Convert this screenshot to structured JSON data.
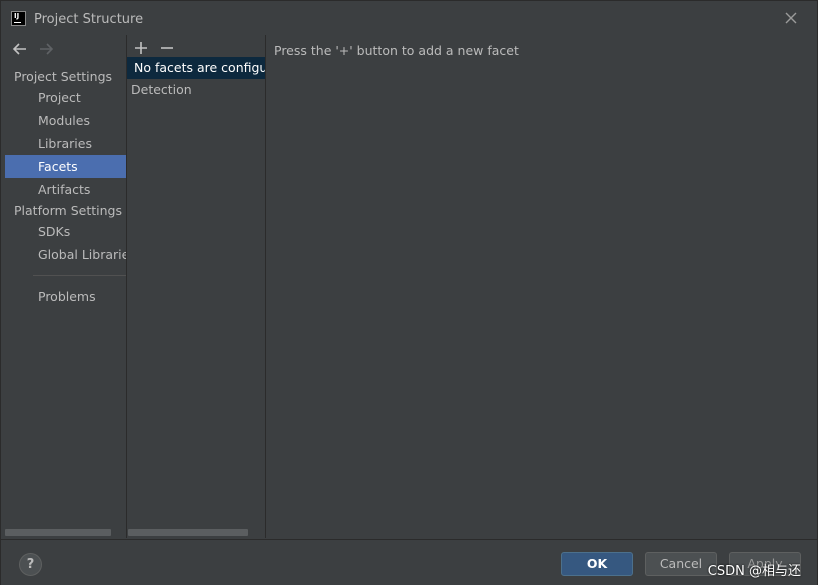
{
  "window": {
    "title": "Project Structure",
    "app_icon_text": "IJ"
  },
  "sidebar": {
    "project_settings_header": "Project Settings",
    "platform_settings_header": "Platform Settings",
    "items": [
      {
        "label": "Project"
      },
      {
        "label": "Modules"
      },
      {
        "label": "Libraries"
      },
      {
        "label": "Facets",
        "selected": true
      },
      {
        "label": "Artifacts"
      },
      {
        "label": "SDKs"
      },
      {
        "label": "Global Libraries"
      },
      {
        "label": "Problems"
      }
    ]
  },
  "facets_list": {
    "add_label": "+",
    "remove_label": "−",
    "rows": [
      {
        "label": "No facets are configured",
        "selected": true
      },
      {
        "label": "Detection"
      }
    ]
  },
  "detail": {
    "hint": "Press the '+' button to add a new facet"
  },
  "footer": {
    "help_label": "?",
    "ok_label": "OK",
    "cancel_label": "Cancel",
    "apply_label": "Apply",
    "watermark": "CSDN @相与还"
  },
  "colors": {
    "background": "#3c3f41",
    "selection": "#4b6eaf",
    "list_selection": "#0d293e",
    "ok_button": "#365880",
    "text": "#bbbbbb"
  }
}
